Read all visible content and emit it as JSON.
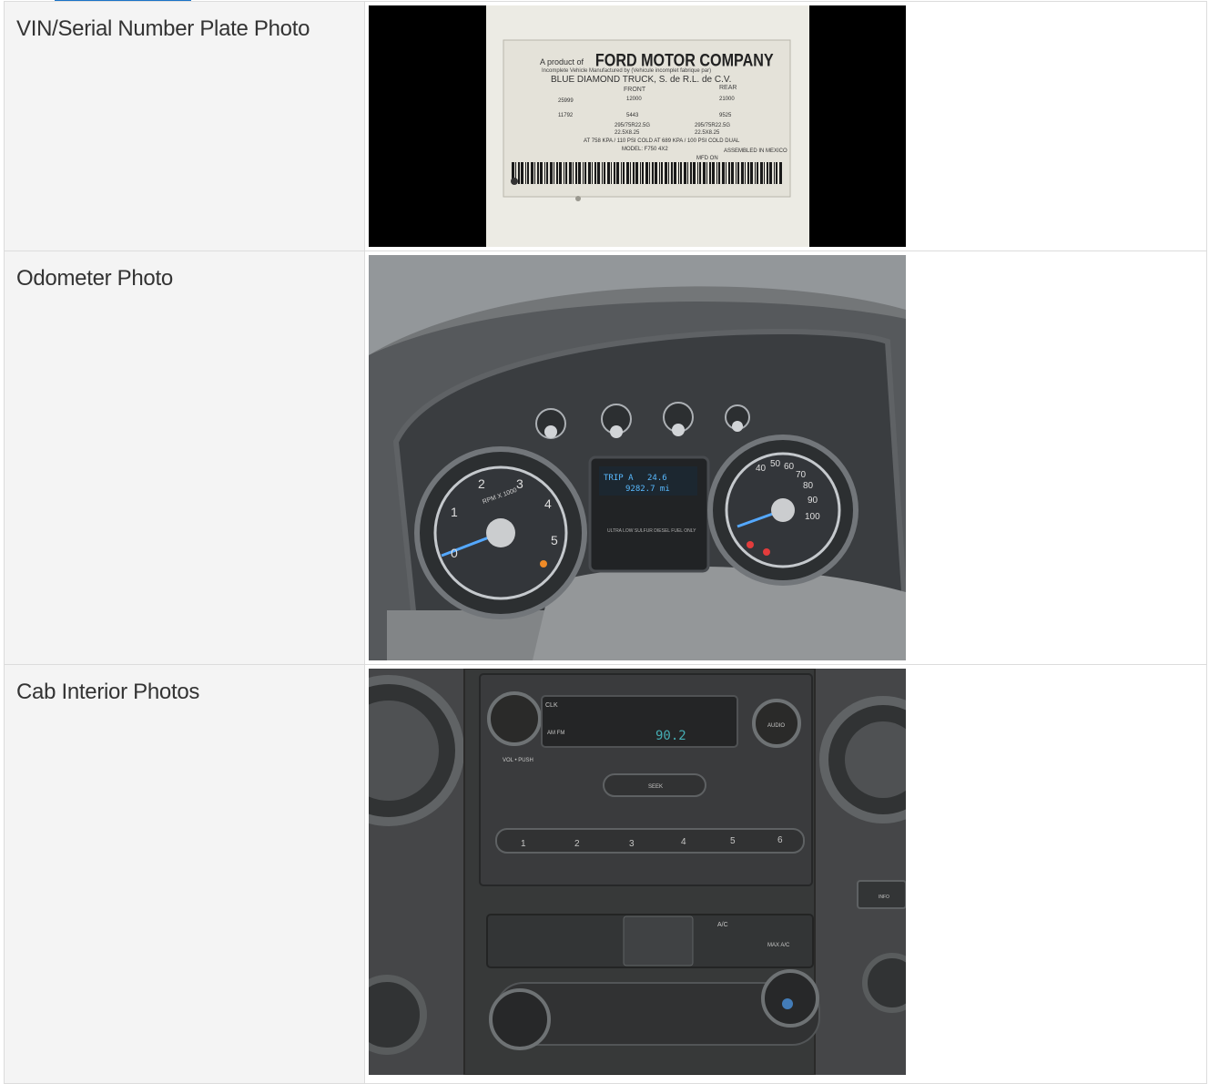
{
  "rows": [
    {
      "label": "VIN/Serial Number Plate Photo",
      "photo": {
        "name": "vin-plate-photo",
        "maker_line": "A product of",
        "brand": "FORD MOTOR COMPANY",
        "incomplete_line": "Incomplete Vehicle Manufactured by (Vehicule incomplet fabrique par)",
        "manufacturer": "BLUE DIAMOND TRUCK, S. de R.L. de C.V.",
        "front_label": "FRONT",
        "rear_label": "REAR",
        "gvwr_lb": "25999",
        "gvwr_kg": "11792",
        "front_gawr_lb": "12000",
        "front_gawr_kg": "5443",
        "rear_gawr_lb": "21000",
        "rear_gawr_kg": "9525",
        "front_tires": "295/75R22.5G",
        "front_rims": "22.5X8.25",
        "rear_tires": "295/75R22.5G",
        "rear_rims": "22.5X8.25",
        "pressure_line": "AT 758 KPA / 110 PSI COLD AT 689 KPA / 100 PSI COLD DUAL",
        "model": "MODEL: F750 4X2",
        "assembled": "ASSEMBLED IN MEXICO",
        "mfd_on": "MFD ON"
      }
    },
    {
      "label": "Odometer Photo",
      "photo": {
        "name": "odometer-photo",
        "trip_label": "TRIP A",
        "trip_value": "24.6",
        "odometer": "9282.7 mi",
        "rpm_label": "RPM X 1000",
        "fuel_notice": "ULTRA LOW SULFUR DIESEL FUEL ONLY",
        "speed_marks": [
          "40",
          "50",
          "60",
          "70",
          "80",
          "90",
          "100"
        ],
        "rpm_marks": [
          "0",
          "1",
          "2",
          "3",
          "4",
          "5"
        ]
      }
    },
    {
      "label": "Cab Interior Photos",
      "photo": {
        "name": "cab-interior-photo",
        "radio_display": "90.2",
        "clk": "CLK",
        "am_fm": "AM FM",
        "vol_push": "VOL • PUSH",
        "audio": "AUDIO",
        "seek": "SEEK",
        "presets": [
          "1",
          "2",
          "3",
          "4",
          "5",
          "6"
        ],
        "ac": "A/C",
        "max_ac": "MAX A/C",
        "info": "INFO"
      }
    }
  ]
}
